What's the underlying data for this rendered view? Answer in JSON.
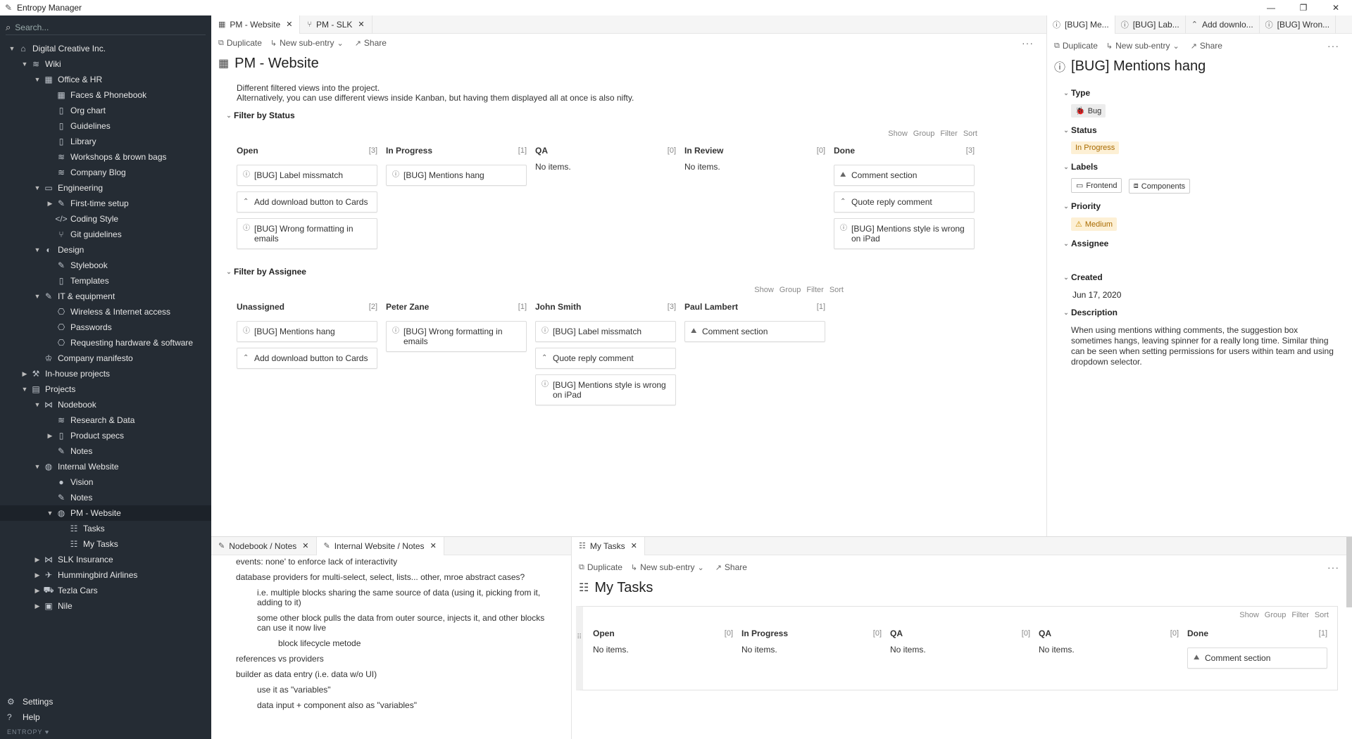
{
  "app": {
    "title": "Entropy Manager",
    "icon": "app-logo-icon",
    "controls": [
      "minimize-icon",
      "maximize-icon",
      "close-icon"
    ]
  },
  "sidebar": {
    "search_placeholder": "Search...",
    "tree": [
      {
        "label": "Digital Creative Inc.",
        "depth": 0,
        "expander": "open",
        "icon": "home-icon"
      },
      {
        "label": "Wiki",
        "depth": 1,
        "expander": "open",
        "icon": "layers-icon"
      },
      {
        "label": "Office & HR",
        "depth": 2,
        "expander": "open",
        "icon": "grid-icon"
      },
      {
        "label": "Faces & Phonebook",
        "depth": 3,
        "expander": "none",
        "icon": "grid-icon"
      },
      {
        "label": "Org chart",
        "depth": 3,
        "expander": "none",
        "icon": "book-icon"
      },
      {
        "label": "Guidelines",
        "depth": 3,
        "expander": "none",
        "icon": "book-icon"
      },
      {
        "label": "Library",
        "depth": 3,
        "expander": "none",
        "icon": "book-icon"
      },
      {
        "label": "Workshops & brown bags",
        "depth": 3,
        "expander": "none",
        "icon": "layers-icon"
      },
      {
        "label": "Company Blog",
        "depth": 3,
        "expander": "none",
        "icon": "layers-icon"
      },
      {
        "label": "Engineering",
        "depth": 2,
        "expander": "open",
        "icon": "monitor-icon"
      },
      {
        "label": "First-time setup",
        "depth": 3,
        "expander": "closed",
        "icon": "wrench-icon"
      },
      {
        "label": "Coding Style",
        "depth": 3,
        "expander": "none",
        "icon": "code-icon"
      },
      {
        "label": "Git guidelines",
        "depth": 3,
        "expander": "none",
        "icon": "branch-icon"
      },
      {
        "label": "Design",
        "depth": 2,
        "expander": "open",
        "icon": "palette-icon"
      },
      {
        "label": "Stylebook",
        "depth": 3,
        "expander": "none",
        "icon": "note-icon"
      },
      {
        "label": "Templates",
        "depth": 3,
        "expander": "none",
        "icon": "book-icon"
      },
      {
        "label": "IT & equipment",
        "depth": 2,
        "expander": "open",
        "icon": "wrench-icon"
      },
      {
        "label": "Wireless & Internet access",
        "depth": 3,
        "expander": "none",
        "icon": "network-icon"
      },
      {
        "label": "Passwords",
        "depth": 3,
        "expander": "none",
        "icon": "network-icon"
      },
      {
        "label": "Requesting hardware & software",
        "depth": 3,
        "expander": "none",
        "icon": "network-icon"
      },
      {
        "label": "Company manifesto",
        "depth": 2,
        "expander": "none",
        "icon": "crown-icon"
      },
      {
        "label": "In-house projects",
        "depth": 1,
        "expander": "closed",
        "icon": "hammer-icon"
      },
      {
        "label": "Projects",
        "depth": 1,
        "expander": "open",
        "icon": "briefcase-icon"
      },
      {
        "label": "Nodebook",
        "depth": 2,
        "expander": "open",
        "icon": "nodes-icon"
      },
      {
        "label": "Research & Data",
        "depth": 3,
        "expander": "none",
        "icon": "layers-icon"
      },
      {
        "label": "Product specs",
        "depth": 3,
        "expander": "closed",
        "icon": "book-icon"
      },
      {
        "label": "Notes",
        "depth": 3,
        "expander": "none",
        "icon": "note-icon"
      },
      {
        "label": "Internal Website",
        "depth": 2,
        "expander": "open",
        "icon": "globe-icon"
      },
      {
        "label": "Vision",
        "depth": 3,
        "expander": "none",
        "icon": "bulb-icon"
      },
      {
        "label": "Notes",
        "depth": 3,
        "expander": "none",
        "icon": "note-icon"
      },
      {
        "label": "PM - Website",
        "depth": 3,
        "expander": "open",
        "icon": "globe-icon",
        "active": true
      },
      {
        "label": "Tasks",
        "depth": 4,
        "expander": "none",
        "icon": "checklist-icon"
      },
      {
        "label": "My Tasks",
        "depth": 4,
        "expander": "none",
        "icon": "checklist-icon"
      },
      {
        "label": "SLK Insurance",
        "depth": 2,
        "expander": "closed",
        "icon": "nodes-icon"
      },
      {
        "label": "Hummingbird Airlines",
        "depth": 2,
        "expander": "closed",
        "icon": "plane-icon"
      },
      {
        "label": "Tezla Cars",
        "depth": 2,
        "expander": "closed",
        "icon": "car-icon"
      },
      {
        "label": "Nile",
        "depth": 2,
        "expander": "closed",
        "icon": "calendar-icon"
      }
    ],
    "settings_label": "Settings",
    "help_label": "Help",
    "brand": "ENTROPY ♥"
  },
  "main": {
    "tabs": [
      {
        "label": "PM - Website",
        "icon": "board-icon"
      },
      {
        "label": "PM - SLK",
        "icon": "branch-icon"
      }
    ],
    "toolbar": {
      "duplicate": "Duplicate",
      "new_sub": "New sub-entry",
      "share": "Share"
    },
    "title": "PM - Website",
    "description_1": "Different filtered views into the project.",
    "description_2": "Alternatively, you can use different views inside Kanban, but having them displayed all at once is also nifty.",
    "board_controls": [
      "Show",
      "Group",
      "Filter",
      "Sort"
    ],
    "status_section": {
      "title": "Filter by Status",
      "columns": [
        {
          "name": "Open",
          "count": "[3]",
          "cards": [
            {
              "icon": "bug-icon",
              "text": "[BUG] Label missmatch"
            },
            {
              "icon": "feature-icon",
              "text": "Add download button to Cards"
            },
            {
              "icon": "bug-icon",
              "text": "[BUG] Wrong formatting in emails"
            }
          ]
        },
        {
          "name": "In Progress",
          "count": "[1]",
          "cards": [
            {
              "icon": "bug-icon",
              "text": "[BUG] Mentions hang"
            }
          ]
        },
        {
          "name": "QA",
          "count": "[0]",
          "empty": "No items."
        },
        {
          "name": "In Review",
          "count": "[0]",
          "empty": "No items."
        },
        {
          "name": "Done",
          "count": "[3]",
          "cards": [
            {
              "icon": "mountain-icon",
              "text": "Comment section"
            },
            {
              "icon": "feature-icon",
              "text": "Quote reply comment"
            },
            {
              "icon": "bug-icon",
              "text": "[BUG] Mentions style is wrong on iPad"
            }
          ]
        }
      ]
    },
    "assignee_section": {
      "title": "Filter by Assignee",
      "columns": [
        {
          "name": "Unassigned",
          "count": "[2]",
          "cards": [
            {
              "icon": "bug-icon",
              "text": "[BUG] Mentions hang"
            },
            {
              "icon": "feature-icon",
              "text": "Add download button to Cards"
            }
          ]
        },
        {
          "name": "Peter Zane",
          "count": "[1]",
          "cards": [
            {
              "icon": "bug-icon",
              "text": "[BUG] Wrong formatting in emails"
            }
          ]
        },
        {
          "name": "John Smith",
          "count": "[3]",
          "cards": [
            {
              "icon": "bug-icon",
              "text": "[BUG] Label missmatch"
            },
            {
              "icon": "feature-icon",
              "text": "Quote reply comment"
            },
            {
              "icon": "bug-icon",
              "text": "[BUG] Mentions style is wrong on iPad"
            }
          ]
        },
        {
          "name": "Paul Lambert",
          "count": "[1]",
          "cards": [
            {
              "icon": "mountain-icon",
              "text": "Comment section"
            }
          ]
        }
      ]
    }
  },
  "detail": {
    "tabs": [
      {
        "label": "[BUG] Me...",
        "icon": "bug-icon"
      },
      {
        "label": "[BUG] Lab...",
        "icon": "bug-icon"
      },
      {
        "label": "Add downlo...",
        "icon": "feature-icon"
      },
      {
        "label": "[BUG] Wron...",
        "icon": "bug-icon"
      }
    ],
    "toolbar": {
      "duplicate": "Duplicate",
      "new_sub": "New sub-entry",
      "share": "Share"
    },
    "title": "[BUG] Mentions hang",
    "type_label": "Type",
    "type_value": "Bug",
    "status_label": "Status",
    "status_value": "In Progress",
    "labels_label": "Labels",
    "labels": [
      "Frontend",
      "Components"
    ],
    "priority_label": "Priority",
    "priority_value": "Medium",
    "assignee_label": "Assignee",
    "created_label": "Created",
    "created_value": "Jun 17, 2020",
    "description_label": "Description",
    "description_value": "When using mentions withing comments, the suggestion box sometimes hangs, leaving spinner for a really long time. Similar thing can be seen when setting permissions for users within team and using dropdown selector.",
    "colors": {
      "status_bg": "#fdf0d5",
      "status_fg": "#a86a00",
      "priority_bg": "#fdf0d5",
      "priority_fg": "#a86a00",
      "label_border": "#cccccc"
    }
  },
  "notes": {
    "tabs": [
      {
        "label": "Nodebook / Notes",
        "icon": "note-icon"
      },
      {
        "label": "Internal Website / Notes",
        "icon": "note-icon"
      }
    ],
    "lines": [
      {
        "indent": 0,
        "text": "events: none' to enforce lack of interactivity"
      },
      {
        "indent": 0,
        "text": "database providers for multi-select, select, lists... other, mroe abstract cases?"
      },
      {
        "indent": 1,
        "text": "i.e. multiple blocks sharing the same source of data (using it, picking from it, adding to it)"
      },
      {
        "indent": 1,
        "text": "some other block pulls the data from outer source, injects it, and other blocks can use it now live"
      },
      {
        "indent": 2,
        "text": "block lifecycle metode"
      },
      {
        "indent": 0,
        "text": "references vs providers"
      },
      {
        "indent": 0,
        "text": "builder as data entry (i.e. data w/o UI)"
      },
      {
        "indent": 1,
        "text": "use it as \"variables\""
      },
      {
        "indent": 1,
        "text": "data input + component also as \"variables\""
      }
    ]
  },
  "mytasks": {
    "tabs": [
      {
        "label": "My Tasks",
        "icon": "checklist-icon"
      }
    ],
    "toolbar": {
      "duplicate": "Duplicate",
      "new_sub": "New sub-entry",
      "share": "Share"
    },
    "title": "My Tasks",
    "board_controls": [
      "Show",
      "Group",
      "Filter",
      "Sort"
    ],
    "columns": [
      {
        "name": "Open",
        "count": "[0]",
        "empty": "No items."
      },
      {
        "name": "In Progress",
        "count": "[0]",
        "empty": "No items."
      },
      {
        "name": "QA",
        "count": "[0]",
        "empty": "No items."
      },
      {
        "name": "QA",
        "count": "[0]",
        "empty": "No items."
      },
      {
        "name": "Done",
        "count": "[1]",
        "cards": [
          {
            "icon": "mountain-icon",
            "text": "Comment section"
          }
        ]
      }
    ]
  }
}
